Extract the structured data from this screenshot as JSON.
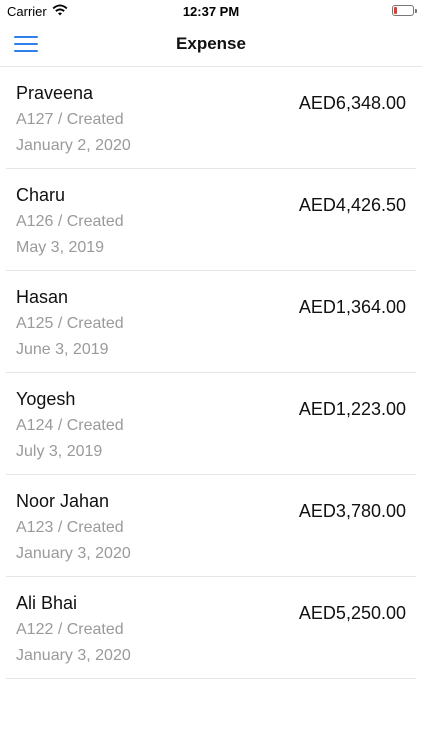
{
  "status": {
    "carrier": "Carrier",
    "time": "12:37 PM"
  },
  "nav": {
    "title": "Expense",
    "menu_icon": "hamburger-menu-icon"
  },
  "colors": {
    "accent": "#2f80ed",
    "muted": "#9a9a9a",
    "battery_low": "#e53935"
  },
  "expenses": [
    {
      "name": "Praveena",
      "code_status": "A127 / Created",
      "date": "January 2, 2020",
      "amount": "AED6,348.00"
    },
    {
      "name": "Charu",
      "code_status": "A126 / Created",
      "date": "May 3, 2019",
      "amount": "AED4,426.50"
    },
    {
      "name": "Hasan",
      "code_status": "A125 / Created",
      "date": "June 3, 2019",
      "amount": "AED1,364.00"
    },
    {
      "name": "Yogesh",
      "code_status": "A124 / Created",
      "date": "July 3, 2019",
      "amount": "AED1,223.00"
    },
    {
      "name": "Noor Jahan",
      "code_status": "A123 / Created",
      "date": "January 3, 2020",
      "amount": "AED3,780.00"
    },
    {
      "name": "Ali Bhai",
      "code_status": "A122 / Created",
      "date": "January 3, 2020",
      "amount": "AED5,250.00"
    }
  ]
}
